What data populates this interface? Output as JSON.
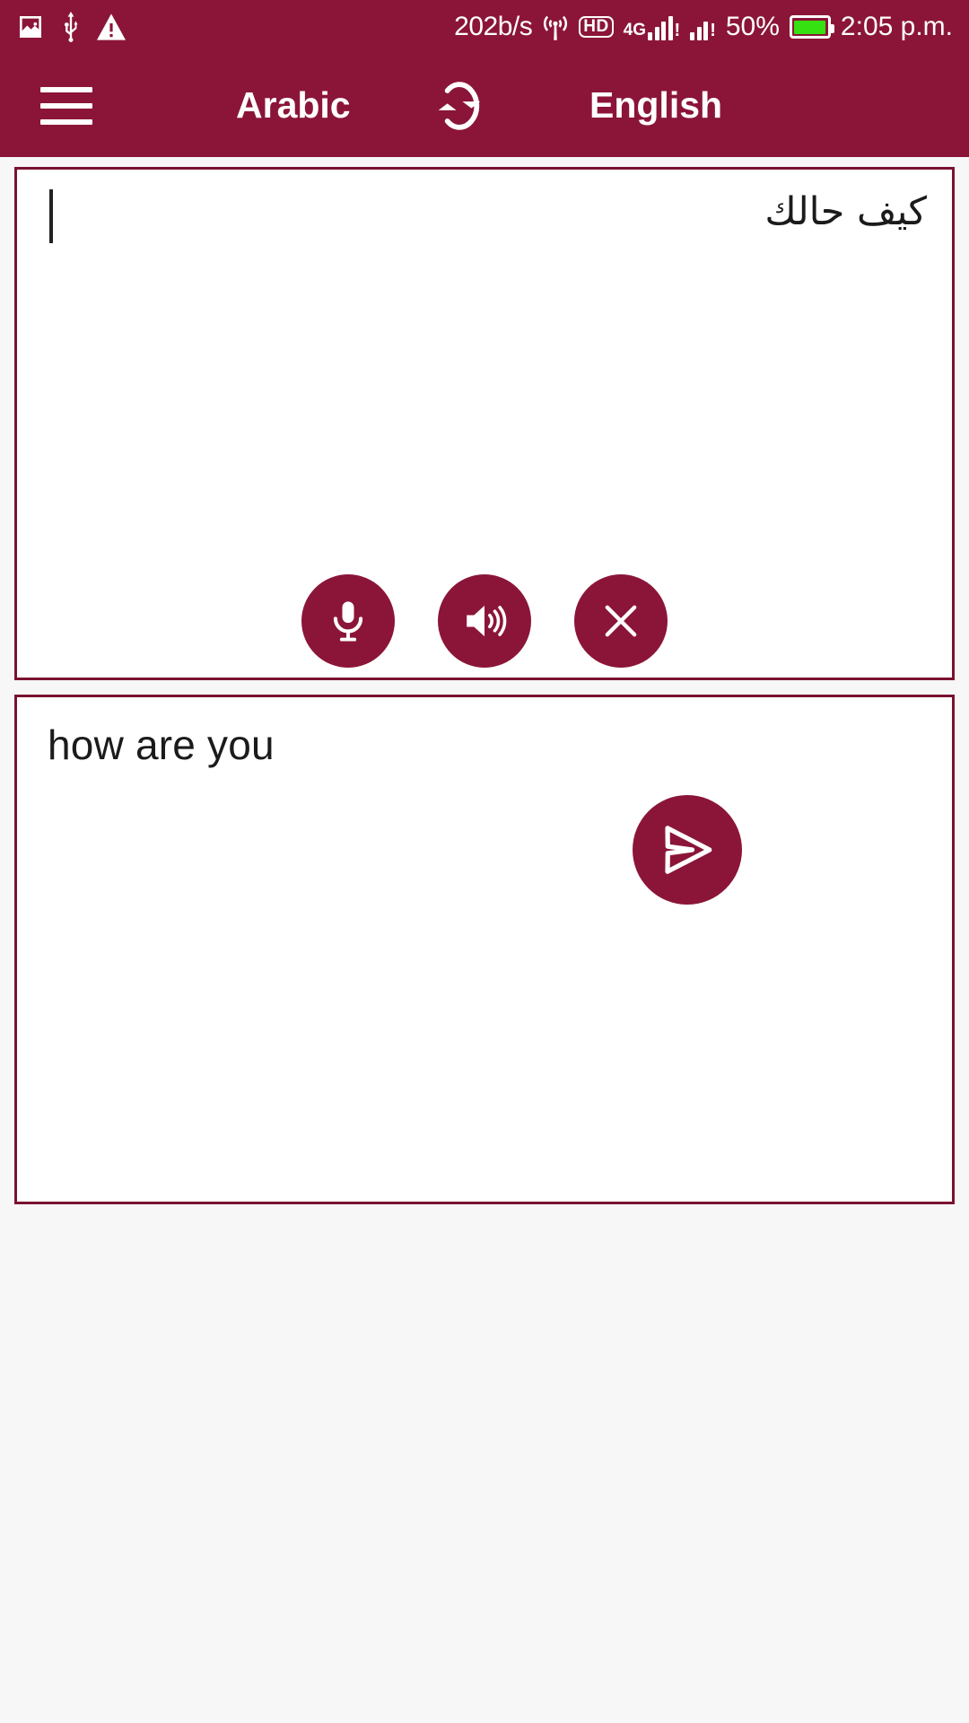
{
  "status_bar": {
    "icons_left": [
      "image-icon",
      "usb-icon",
      "warning-icon"
    ],
    "network_speed": "202b/s",
    "hotspot_icon": "hotspot-icon",
    "hd_badge": "HD",
    "network_generation": "4G",
    "signal_exclaim": "!",
    "battery_percent": "50%",
    "battery_color": "#35e111",
    "time": "2:05 p.m."
  },
  "header": {
    "menu_icon": "hamburger-menu-icon",
    "source_language": "Arabic",
    "swap_icon": "swap-languages-icon",
    "target_language": "English",
    "background_color": "#8B1538"
  },
  "source_panel": {
    "text": "كيف حالك",
    "has_caret": true
  },
  "target_panel": {
    "text": "how are you"
  },
  "actions": {
    "mic_label": "microphone-icon",
    "speaker_label": "speaker-icon",
    "clear_label": "close-icon",
    "send_label": "send-icon"
  },
  "colors": {
    "accent": "#8B1538",
    "panel_border": "#7a1230",
    "page_background": "#f7f7f8"
  }
}
